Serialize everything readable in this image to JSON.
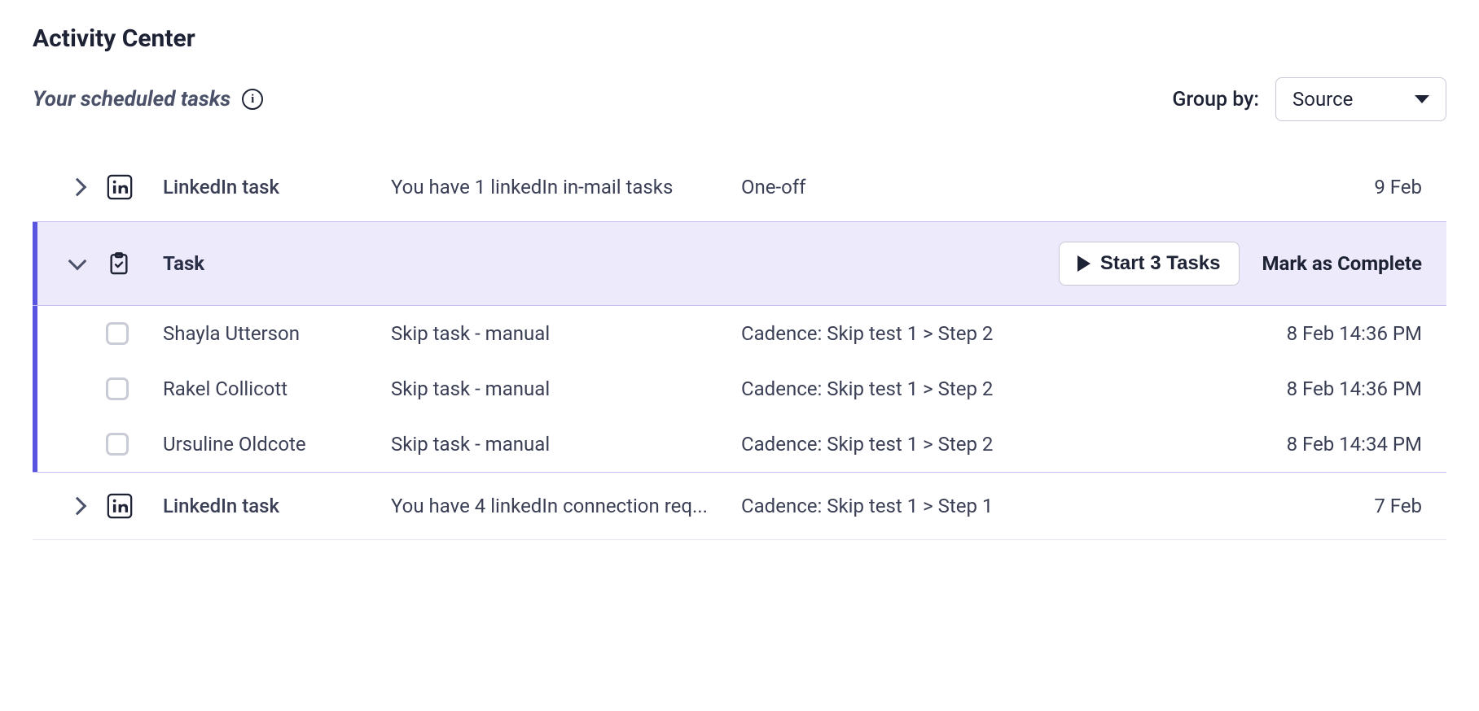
{
  "header": {
    "title": "Activity Center",
    "subtitle": "Your scheduled tasks",
    "group_by_label": "Group by:",
    "group_by_value": "Source"
  },
  "groups": {
    "linkedin1": {
      "type": "LinkedIn task",
      "desc": "You have 1 linkedIn in-mail tasks",
      "cadence": "One-off",
      "date": "9 Feb"
    },
    "task_group": {
      "type": "Task",
      "start_label": "Start 3 Tasks",
      "complete_label": "Mark as Complete"
    },
    "linkedin2": {
      "type": "LinkedIn task",
      "desc": "You have 4 linkedIn connection req...",
      "cadence": "Cadence: Skip test 1 > Step 1",
      "date": "7 Feb"
    }
  },
  "tasks": [
    {
      "person": "Shayla Utterson",
      "action": "Skip task - manual",
      "cadence": "Cadence: Skip test 1 > Step 2",
      "time": "8 Feb 14:36 PM"
    },
    {
      "person": "Rakel Collicott",
      "action": "Skip task - manual",
      "cadence": "Cadence: Skip test 1 > Step 2",
      "time": "8 Feb 14:36 PM"
    },
    {
      "person": "Ursuline Oldcote",
      "action": "Skip task - manual",
      "cadence": "Cadence: Skip test 1 > Step 2",
      "time": "8 Feb 14:34 PM"
    }
  ]
}
